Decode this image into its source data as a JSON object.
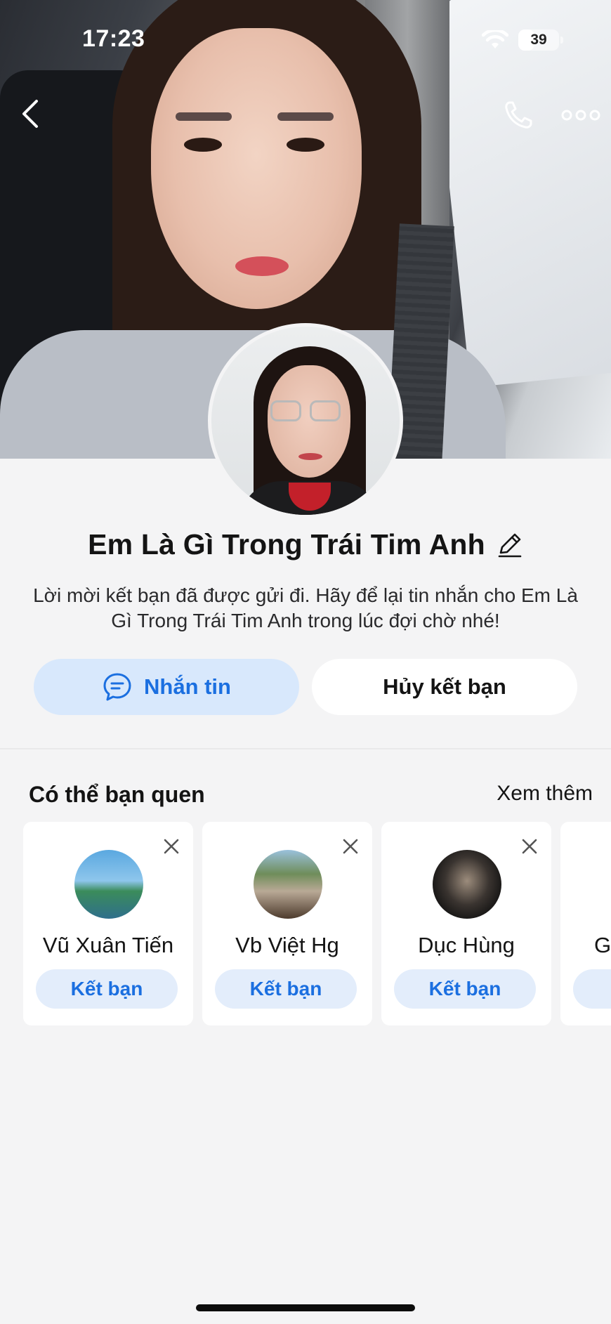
{
  "status_bar": {
    "time": "17:23",
    "battery_level": "39"
  },
  "header": {
    "back_icon": "chevron-left-icon",
    "call_icon": "phone-icon",
    "more_icon": "more-dots-icon"
  },
  "profile": {
    "name": "Em Là Gì Trong Trái Tim Anh",
    "edit_icon": "pencil-icon",
    "request_note": "Lời mời kết bạn đã được gửi đi. Hãy để lại tin nhắn cho Em Là Gì Trong Trái Tim Anh trong lúc đợi chờ nhé!",
    "message_button": "Nhắn tin",
    "unfriend_button": "Hủy kết bạn"
  },
  "suggestions": {
    "title": "Có thể bạn quen",
    "see_more": "Xem thêm",
    "add_label": "Kết bạn",
    "items": [
      {
        "name": "Vũ Xuân Tiến"
      },
      {
        "name": "Vb Việt Hg"
      },
      {
        "name": "Dục Hùng"
      },
      {
        "name": "G"
      }
    ]
  },
  "colors": {
    "accent": "#1b6fe0",
    "accent_soft": "#d8e8fc",
    "background": "#f4f4f5"
  }
}
